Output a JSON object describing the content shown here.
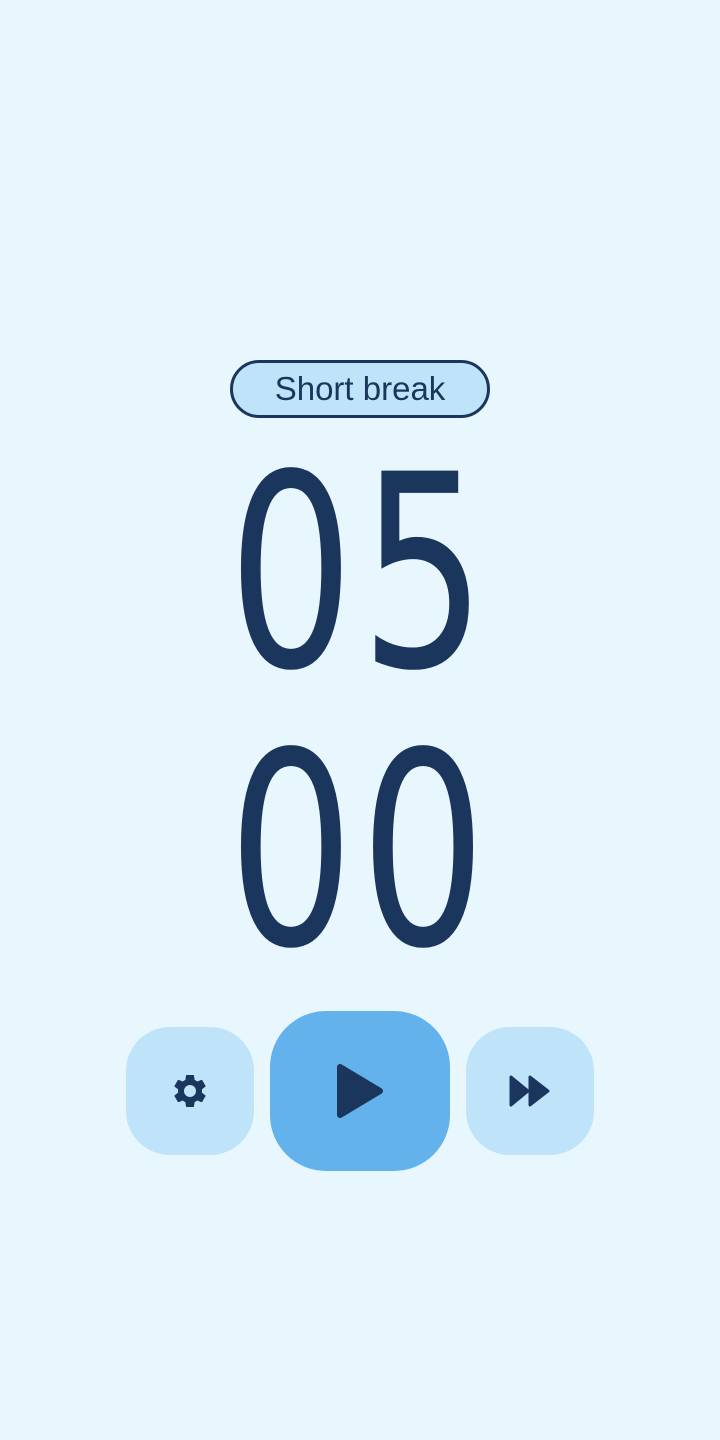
{
  "timer": {
    "mode_label": "Short break",
    "minutes": "05",
    "seconds": "00"
  },
  "controls": {
    "settings_icon": "gear-icon",
    "play_icon": "play-icon",
    "skip_icon": "fast-forward-icon"
  },
  "colors": {
    "background": "#e8f6fd",
    "text": "#1b365c",
    "chip_fill": "#bfe3f8",
    "secondary_button": "#bfe3f8",
    "primary_button": "#63b2eb"
  }
}
